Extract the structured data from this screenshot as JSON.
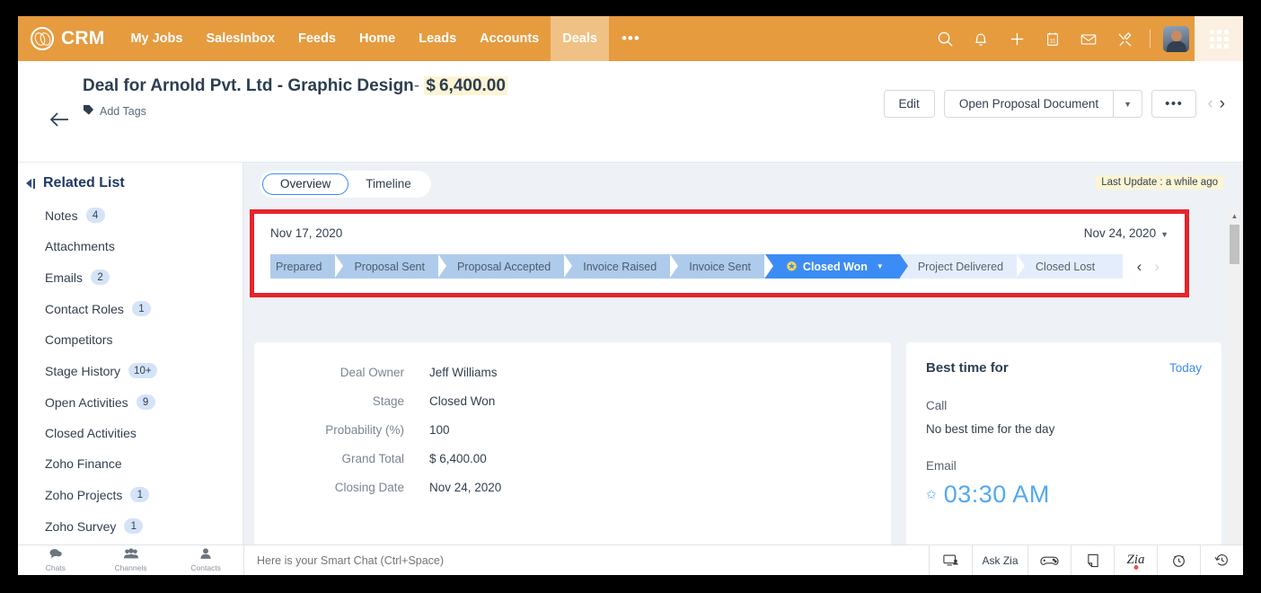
{
  "topnav": {
    "logo_text": "CRM",
    "items": [
      {
        "label": "My Jobs",
        "active": false
      },
      {
        "label": "SalesInbox",
        "active": false
      },
      {
        "label": "Feeds",
        "active": false
      },
      {
        "label": "Home",
        "active": false
      },
      {
        "label": "Leads",
        "active": false
      },
      {
        "label": "Accounts",
        "active": false
      },
      {
        "label": "Deals",
        "active": true
      }
    ],
    "more_label": "•••",
    "accent_color": "#e69b3f",
    "active_tab_color": "#f0c184"
  },
  "record": {
    "title_main": "Deal for Arnold Pvt. Ltd - Graphic Design",
    "title_separator": "-",
    "amount_currency": "$",
    "amount_value": "6,400.00",
    "add_tags_label": "Add Tags",
    "edit_label": "Edit",
    "open_proposal_label": "Open Proposal Document",
    "more_label": "•••"
  },
  "sidebar": {
    "title": "Related List",
    "items": [
      {
        "label": "Notes",
        "count": "4"
      },
      {
        "label": "Attachments",
        "count": ""
      },
      {
        "label": "Emails",
        "count": "2"
      },
      {
        "label": "Contact Roles",
        "count": "1"
      },
      {
        "label": "Competitors",
        "count": ""
      },
      {
        "label": "Stage History",
        "count": "10+"
      },
      {
        "label": "Open Activities",
        "count": "9"
      },
      {
        "label": "Closed Activities",
        "count": ""
      },
      {
        "label": "Zoho Finance",
        "count": ""
      },
      {
        "label": "Zoho Projects",
        "count": "1"
      },
      {
        "label": "Zoho Survey",
        "count": "1"
      }
    ]
  },
  "tabs": {
    "items": [
      {
        "label": "Overview",
        "active": true
      },
      {
        "label": "Timeline",
        "active": false
      }
    ],
    "last_update": "Last Update : a while ago"
  },
  "pipeline": {
    "start_date": "Nov 17, 2020",
    "end_date": "Nov 24, 2020",
    "highlight_color": "#e8232a",
    "done_color": "#aecbec",
    "current_color": "#3c8cf5",
    "future_color": "#e4edfb",
    "stages": [
      {
        "label": "Prepared",
        "state": "done"
      },
      {
        "label": "Proposal Sent",
        "state": "done"
      },
      {
        "label": "Proposal Accepted",
        "state": "done"
      },
      {
        "label": "Invoice Raised",
        "state": "done"
      },
      {
        "label": "Invoice Sent",
        "state": "done"
      },
      {
        "label": "Closed Won",
        "state": "current"
      },
      {
        "label": "Project Delivered",
        "state": "future"
      },
      {
        "label": "Closed Lost",
        "state": "future"
      }
    ]
  },
  "details": {
    "fields": [
      {
        "label": "Deal Owner",
        "value": "Jeff Williams"
      },
      {
        "label": "Stage",
        "value": "Closed Won"
      },
      {
        "label": "Probability (%)",
        "value": "100"
      },
      {
        "label": "Grand Total",
        "value": "$ 6,400.00"
      },
      {
        "label": "Closing Date",
        "value": "Nov 24, 2020"
      }
    ]
  },
  "best_time": {
    "title": "Best time for",
    "today_label": "Today",
    "call_label": "Call",
    "call_value": "No best time for the day",
    "email_label": "Email",
    "email_time": "03:30 AM",
    "time_color": "#53a8f0"
  },
  "bottombar": {
    "chat_tabs": [
      {
        "label": "Chats",
        "icon": "chat-bubble-icon"
      },
      {
        "label": "Channels",
        "icon": "people-icon"
      },
      {
        "label": "Contacts",
        "icon": "person-icon"
      }
    ],
    "smart_chat_placeholder": "Here is your Smart Chat (Ctrl+Space)",
    "ask_zia_label": "Ask Zia",
    "zia_label": "Zia"
  }
}
